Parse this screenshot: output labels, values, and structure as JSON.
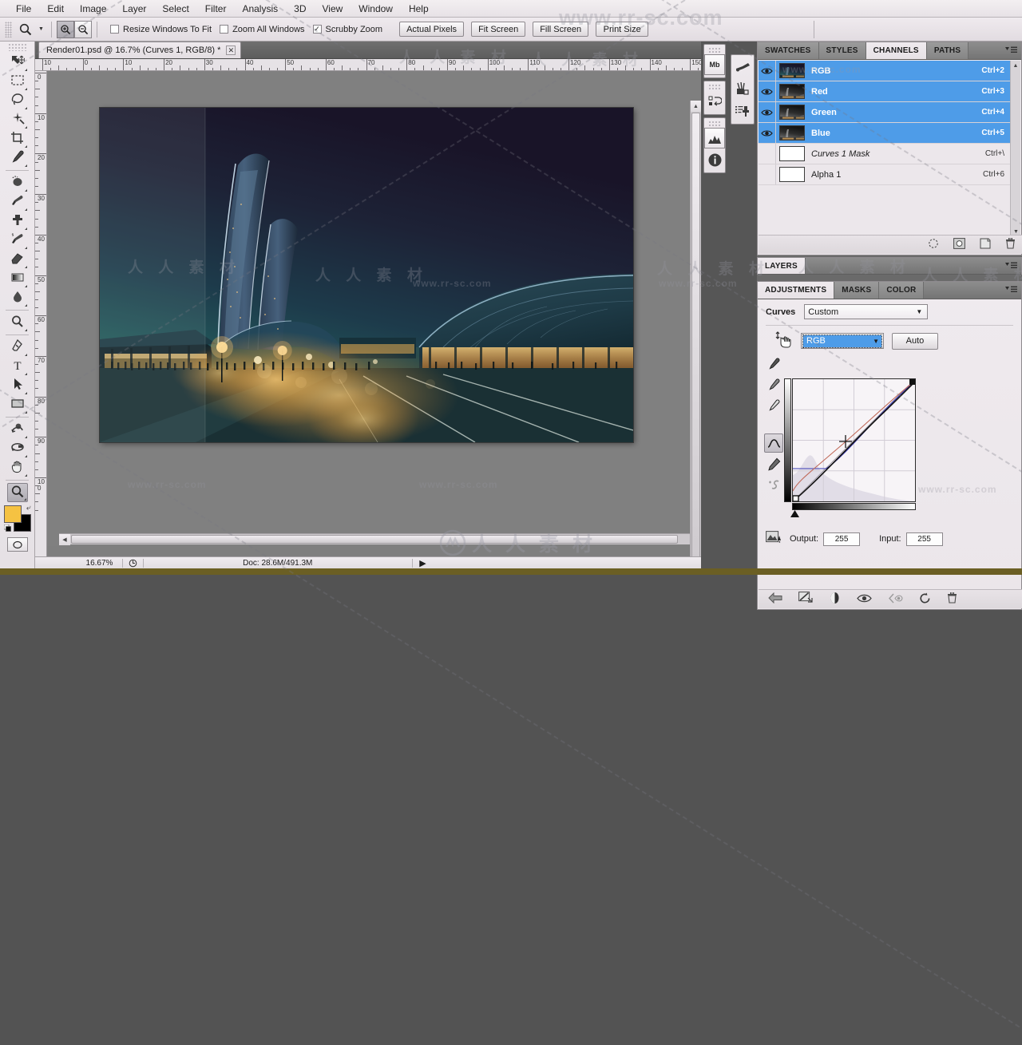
{
  "app": {
    "menubar": [
      "File",
      "Edit",
      "Image",
      "Layer",
      "Select",
      "Filter",
      "Analysis",
      "3D",
      "View",
      "Window",
      "Help"
    ]
  },
  "options_bar": {
    "tool_icon": "zoom-tool-icon",
    "zoom_in_icon": "zoom-in-icon",
    "zoom_out_icon": "zoom-out-icon",
    "checkboxes": [
      {
        "label": "Resize Windows To Fit",
        "checked": false
      },
      {
        "label": "Zoom All Windows",
        "checked": false
      },
      {
        "label": "Scrubby Zoom",
        "checked": true
      }
    ],
    "buttons": [
      "Actual Pixels",
      "Fit Screen",
      "Fill Screen",
      "Print Size"
    ]
  },
  "toolbox": {
    "tools": [
      {
        "name": "move-tool",
        "icon": "move-icon",
        "selected": false
      },
      {
        "name": "marquee-tool",
        "icon": "rect-marquee-icon",
        "selected": false
      },
      {
        "name": "lasso-tool",
        "icon": "lasso-icon",
        "selected": false
      },
      {
        "name": "quick-selection-tool",
        "icon": "magic-wand-icon",
        "selected": false
      },
      {
        "name": "crop-tool",
        "icon": "crop-icon",
        "selected": false
      },
      {
        "name": "eyedropper-tool",
        "icon": "eyedropper-icon",
        "selected": false
      },
      {
        "name": "spot-healing-tool",
        "icon": "healing-brush-icon",
        "selected": false
      },
      {
        "name": "brush-tool",
        "icon": "brush-icon",
        "selected": false
      },
      {
        "name": "clone-stamp-tool",
        "icon": "clone-stamp-icon",
        "selected": false
      },
      {
        "name": "history-brush-tool",
        "icon": "history-brush-icon",
        "selected": false
      },
      {
        "name": "eraser-tool",
        "icon": "eraser-icon",
        "selected": false
      },
      {
        "name": "gradient-tool",
        "icon": "gradient-icon",
        "selected": false
      },
      {
        "name": "blur-tool",
        "icon": "waterdrop-icon",
        "selected": false
      },
      {
        "name": "dodge-tool",
        "icon": "dodge-icon",
        "selected": false
      },
      {
        "name": "pen-tool",
        "icon": "pen-icon",
        "selected": false
      },
      {
        "name": "type-tool",
        "icon": "text-t-icon",
        "selected": false
      },
      {
        "name": "path-selection-tool",
        "icon": "path-arrow-icon",
        "selected": false
      },
      {
        "name": "shape-tool",
        "icon": "rectangle-shape-icon",
        "selected": false
      },
      {
        "name": "rotate-3d-tool",
        "icon": "3d-object-rotate-icon",
        "selected": false
      },
      {
        "name": "orbit-3d-camera-tool",
        "icon": "3d-camera-orbit-icon",
        "selected": false
      },
      {
        "name": "hand-tool",
        "icon": "hand-icon",
        "selected": false
      },
      {
        "name": "zoom-tool",
        "icon": "magnifier-icon",
        "selected": true
      }
    ],
    "foreground_color": "#F5C242",
    "background_color": "#000000",
    "quick_mask_icon": "quick-mask-icon"
  },
  "document": {
    "tab_title": "Render01.psd @ 16.7% (Curves 1, RGB/8) *",
    "close_icon": "close-icon",
    "ruler_h_labels": [
      "10",
      "0",
      "10",
      "20",
      "30",
      "40",
      "50",
      "60",
      "70",
      "80",
      "90",
      "100",
      "110",
      "120",
      "130",
      "140",
      "150"
    ],
    "ruler_v_labels": [
      "0",
      "10",
      "20",
      "30",
      "40",
      "50",
      "60",
      "70",
      "80",
      "90",
      "100"
    ],
    "artwork_alt": "night architectural rendering of futuristic towers and plaza"
  },
  "status_bar": {
    "zoom": "16.67%",
    "doc_icon": "doc-format-icon",
    "doc_info": "Doc: 28.6M/491.3M",
    "expand_icon": "play-triangle-icon"
  },
  "mini_dock": {
    "icons": [
      {
        "name": "mini-bridge-icon",
        "label": "Mb"
      },
      {
        "name": "history-icon",
        "label": ""
      },
      {
        "name": "histogram-icon",
        "label": ""
      },
      {
        "name": "info-icon",
        "label": ""
      }
    ],
    "icons2": [
      {
        "name": "tool-presets-icon",
        "label": ""
      },
      {
        "name": "brush-presets-icon",
        "label": ""
      },
      {
        "name": "clone-source-icon",
        "label": ""
      }
    ],
    "collapse_icon": "double-chevron-right-icon"
  },
  "channels_panel": {
    "tabs": [
      "SWATCHES",
      "STYLES",
      "CHANNELS",
      "PATHS"
    ],
    "active_tab": "CHANNELS",
    "menu_icon": "panel-menu-icon",
    "rows": [
      {
        "name": "RGB",
        "shortcut": "Ctrl+2",
        "selected": true,
        "visible": true,
        "thumb": "composite",
        "italic": false
      },
      {
        "name": "Red",
        "shortcut": "Ctrl+3",
        "selected": true,
        "visible": true,
        "thumb": "gray",
        "italic": false
      },
      {
        "name": "Green",
        "shortcut": "Ctrl+4",
        "selected": true,
        "visible": true,
        "thumb": "gray",
        "italic": false
      },
      {
        "name": "Blue",
        "shortcut": "Ctrl+5",
        "selected": true,
        "visible": true,
        "thumb": "gray",
        "italic": false
      },
      {
        "name": "Curves 1 Mask",
        "shortcut": "Ctrl+\\",
        "selected": false,
        "visible": false,
        "thumb": "white",
        "italic": true
      },
      {
        "name": "Alpha 1",
        "shortcut": "Ctrl+6",
        "selected": false,
        "visible": false,
        "thumb": "white",
        "italic": false
      }
    ],
    "footer_icons": [
      "load-channel-as-selection-icon",
      "save-selection-as-channel-icon",
      "new-channel-icon",
      "delete-channel-icon"
    ],
    "selection_color": "#4E9CE8"
  },
  "layers_bar": {
    "tabs": [
      "LAYERS"
    ],
    "menu_icon": "panel-menu-icon"
  },
  "adjustments_panel": {
    "tabs": [
      "ADJUSTMENTS",
      "MASKS",
      "COLOR"
    ],
    "active_tab": "ADJUSTMENTS",
    "menu_icon": "panel-menu-icon",
    "title": "Curves",
    "preset": "Custom",
    "preset_caret_icon": "chevron-down-icon",
    "channel": "RGB",
    "channel_caret_icon": "chevron-down-icon",
    "auto_button": "Auto",
    "curve_point_cursor_icon": "on-image-adjust-icon",
    "tools": [
      {
        "name": "on-image-adjustment-icon",
        "selected": false
      },
      {
        "name": "black-point-eyedropper-icon",
        "selected": false
      },
      {
        "name": "gray-point-eyedropper-icon",
        "selected": false
      },
      {
        "name": "white-point-eyedropper-icon",
        "selected": false
      },
      {
        "name": "curve-edit-point-icon",
        "selected": true
      },
      {
        "name": "pencil-draw-curve-icon",
        "selected": false
      },
      {
        "name": "smooth-curve-icon",
        "selected": false
      }
    ],
    "output_label": "Output:",
    "output_value": "255",
    "input_label": "Input:",
    "input_value": "255",
    "clip_warning_icon": "clip-warning-icon",
    "footer_icons": [
      "return-to-adjustment-list-icon",
      "clip-to-layer-icon",
      "toggle-layer-mask-icon",
      "toggle-layer-visibility-icon",
      "preview-previous-state-icon",
      "reset-adjustment-icon",
      "delete-adjustment-layer-icon"
    ]
  },
  "watermarks": {
    "url": "www.rr-sc.com",
    "cn": "人 人 素 材",
    "big_url": "www.rr-sc.com"
  },
  "chart_data": null
}
